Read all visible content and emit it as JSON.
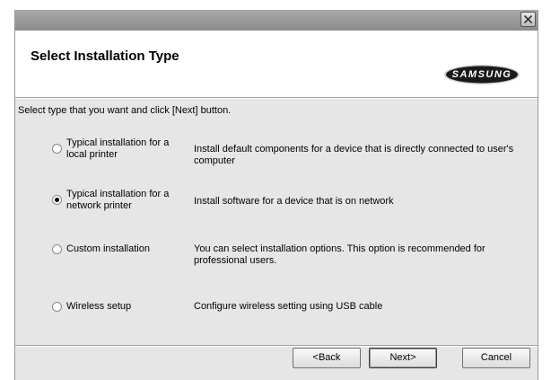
{
  "dialog": {
    "title": "Select Installation Type",
    "logo_text": "SAMSUNG",
    "instruction": "Select type that you want and click [Next] button."
  },
  "options": [
    {
      "label": "Typical installation for a local printer",
      "description": "Install default components for a device that is directly connected to user's computer",
      "selected": false
    },
    {
      "label": "Typical installation for a network printer",
      "description": "Install software for a device that is on network",
      "selected": true
    },
    {
      "label": "Custom installation",
      "description": "You can select installation options. This option is recommended for professional users.",
      "selected": false
    },
    {
      "label": "Wireless setup",
      "description": "Configure wireless setting using USB cable",
      "selected": false
    }
  ],
  "buttons": {
    "back": "<Back",
    "next": "Next>",
    "cancel": "Cancel"
  },
  "icons": {
    "close": "close-icon"
  },
  "colors": {
    "logo_background": "#1a1a1a",
    "logo_ring": "#cfcfcf",
    "title_bar": "#9a9a9a",
    "dialog_background": "#e6e6e6"
  }
}
